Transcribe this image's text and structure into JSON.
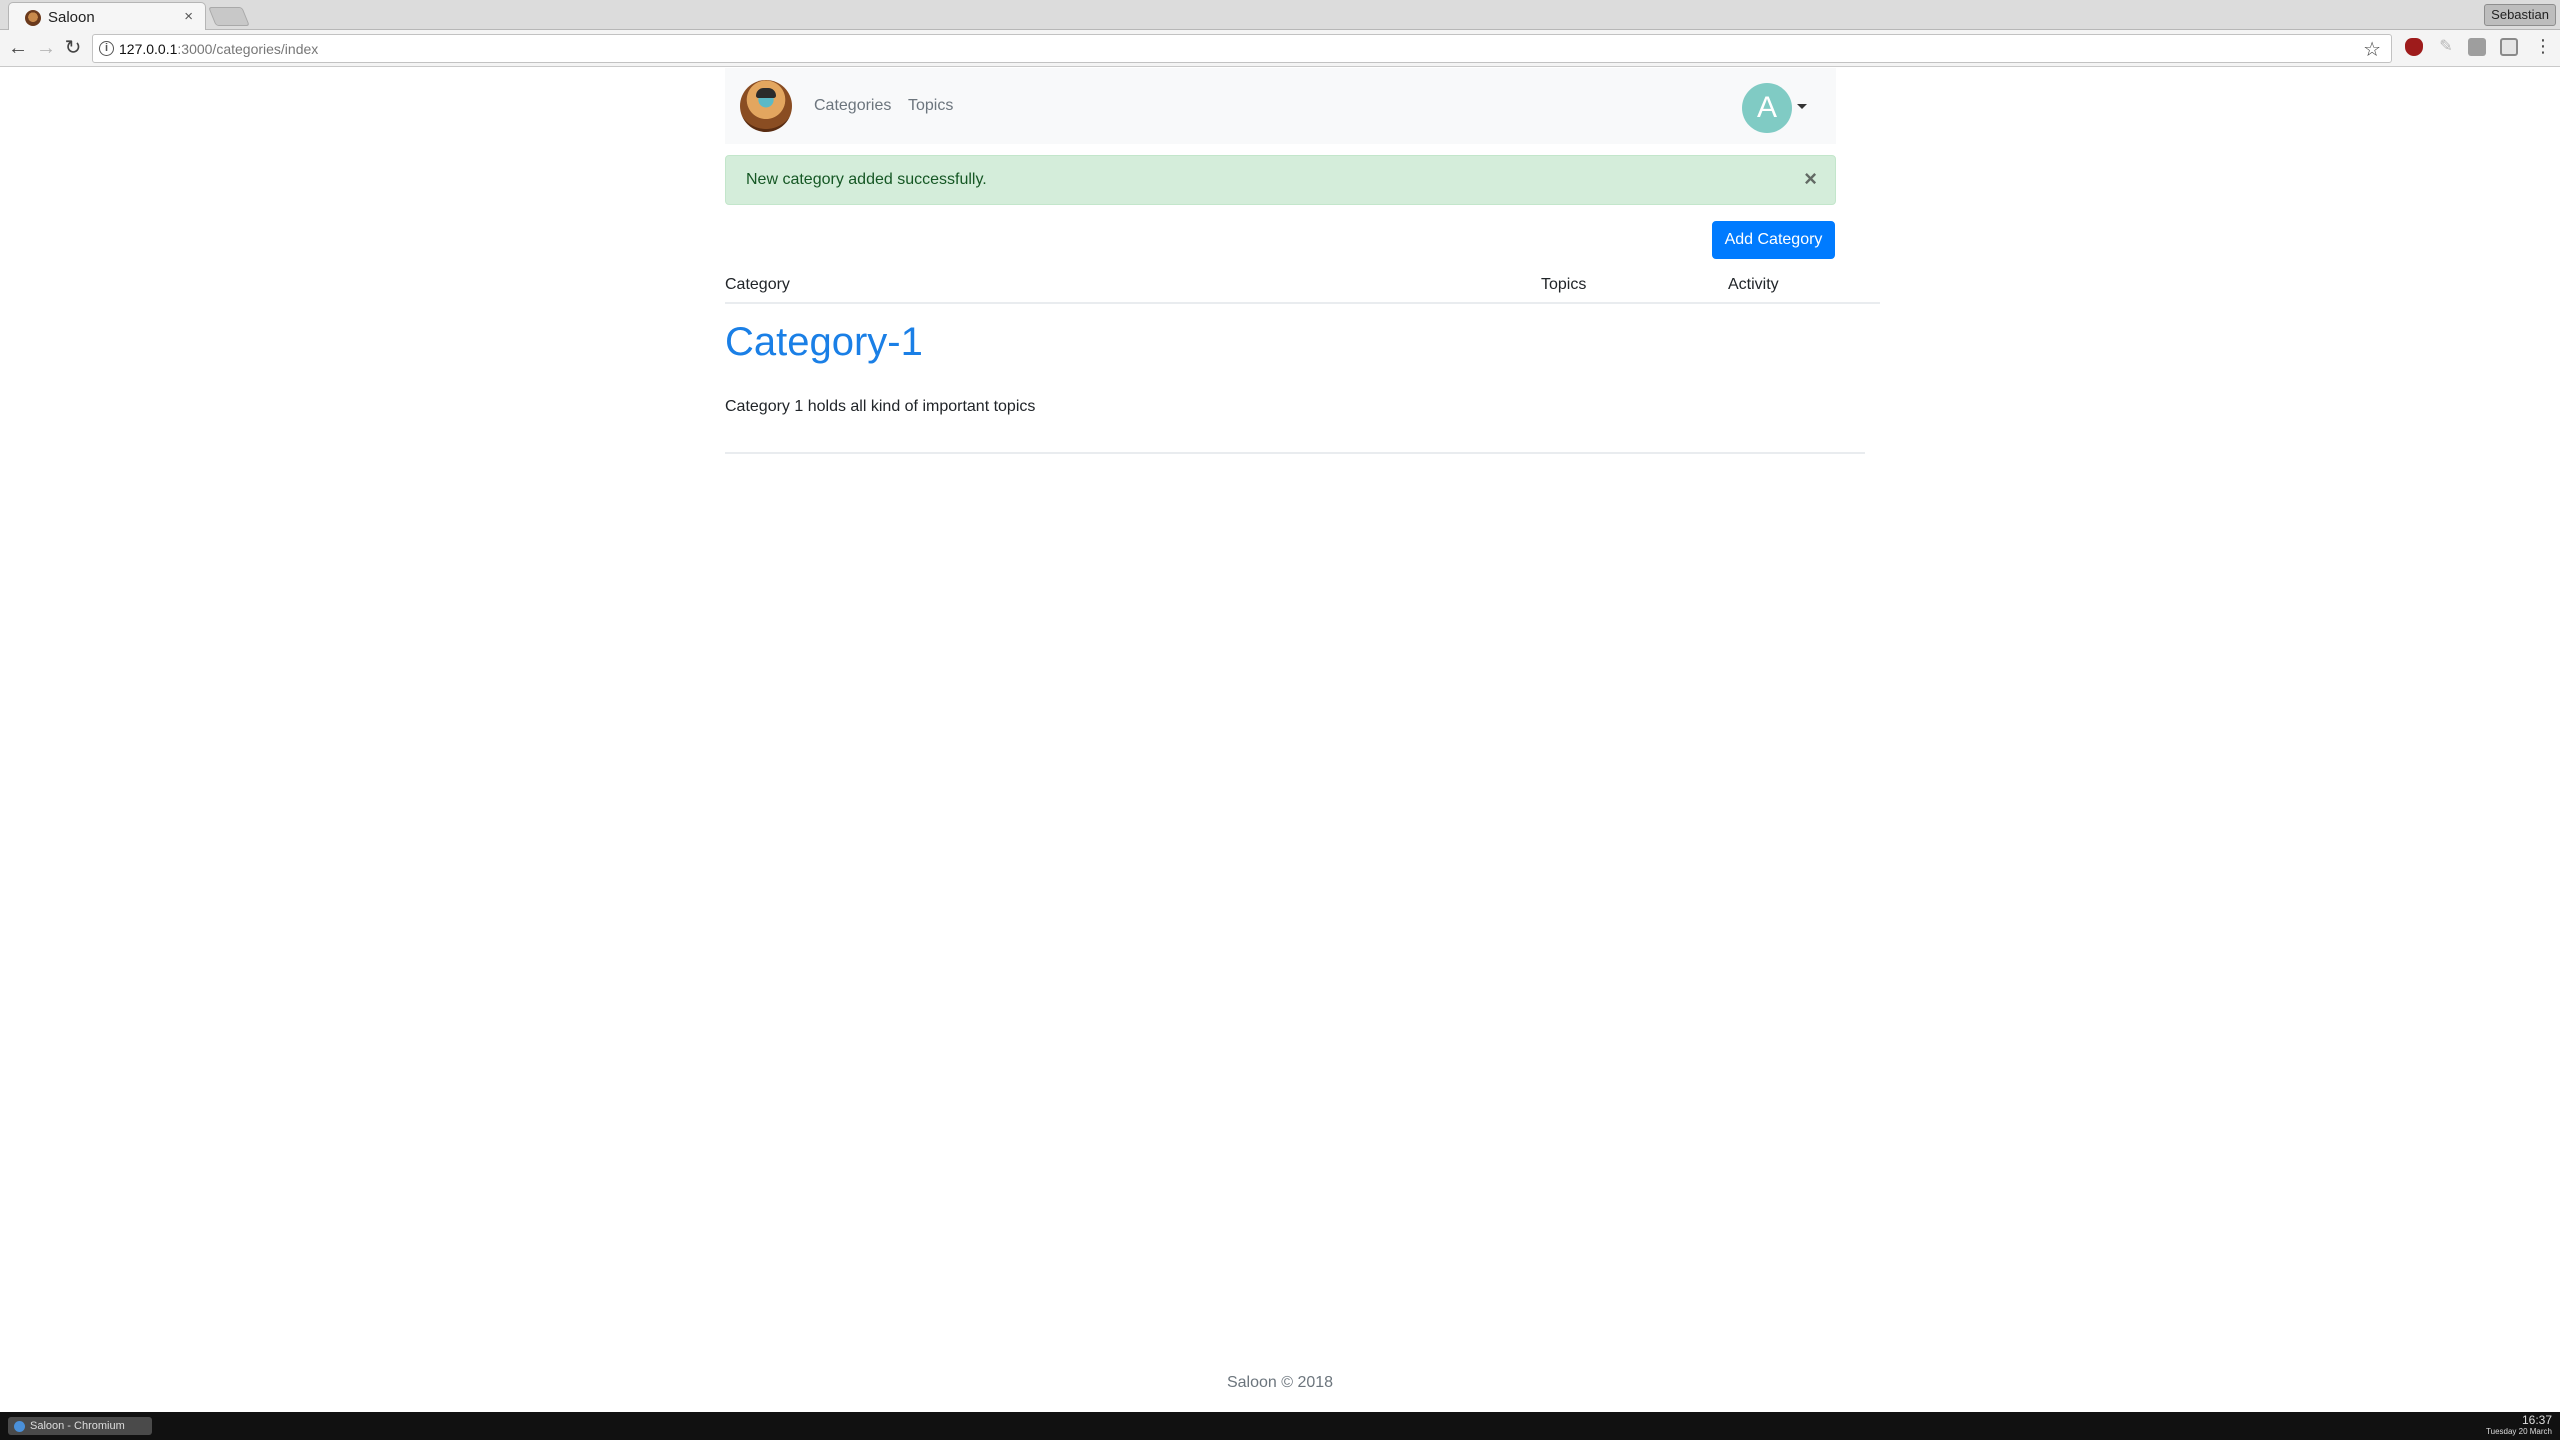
{
  "browser": {
    "tab_title": "Saloon",
    "tab_close": "×",
    "profile_name": "Sebastian",
    "url_host": "127.0.0.1",
    "url_path": ":3000/categories/index",
    "back": "←",
    "forward": "→",
    "reload": "↻",
    "info": "i",
    "star": "☆",
    "menu": "⋮"
  },
  "navbar": {
    "links": [
      "Categories",
      "Topics"
    ],
    "avatar_letter": "A"
  },
  "alert": {
    "message": "New category added successfully.",
    "close": "×"
  },
  "actions": {
    "add_category": "Add Category"
  },
  "table": {
    "headers": [
      "Category",
      "Topics",
      "Activity"
    ],
    "rows": [
      {
        "title": "Category-1",
        "description": "Category 1 holds all kind of important topics",
        "topics": "",
        "activity": ""
      }
    ]
  },
  "footer": {
    "text": "Saloon © 2018"
  },
  "taskbar": {
    "window_title": "Saloon - Chromium",
    "time": "16:37",
    "date": "Tuesday 20 March"
  },
  "colors": {
    "primary": "#007bff",
    "link": "#1a7fe6",
    "alert_bg": "#d4edda",
    "alert_text": "#155724",
    "avatar_bg": "#80cbc4",
    "navbar_bg": "#f8f9fa"
  }
}
